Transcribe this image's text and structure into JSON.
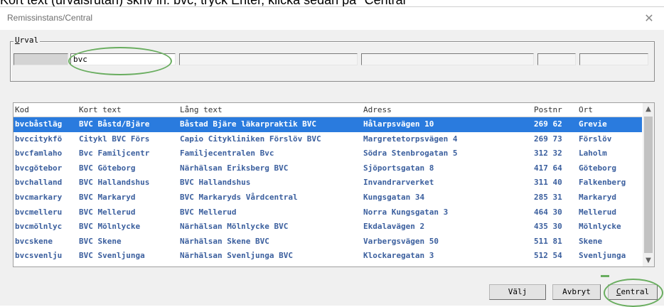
{
  "caption": "Kort text (urvalsrutan) skriv in: bvc, tryck Enter, klicka sedan på \"Central\"",
  "window": {
    "title": "Remissinstans/Central",
    "close_icon": "close-icon"
  },
  "urval": {
    "legend_first": "U",
    "legend_rest": "rval",
    "search_value": "bvc"
  },
  "table": {
    "columns": [
      "Kod",
      "Kort text",
      "Lång text",
      "Adress",
      "Postnr",
      "Ort"
    ],
    "rows": [
      {
        "kod": "bvcbåstläg",
        "kort": "BVC Båstd/Bjäre",
        "lang": "Båstad Bjäre läkarpraktik BVC",
        "adress": "Hålarpsvägen 10",
        "postnr": "269 62",
        "ort": "Grevie"
      },
      {
        "kod": "bvccitykfö",
        "kort": "Citykl BVC Förs",
        "lang": "Capio Citykliniken Förslöv BVC",
        "adress": "Margretetorpsvägen 4",
        "postnr": "269 73",
        "ort": "Förslöv"
      },
      {
        "kod": "bvcfamlaho",
        "kort": "Bvc Familjcentr",
        "lang": "Familjecentralen Bvc",
        "adress": "Södra Stenbrogatan 5",
        "postnr": "312 32",
        "ort": "Laholm"
      },
      {
        "kod": "bvcgötebor",
        "kort": "BVC Göteborg",
        "lang": "Närhälsan Eriksberg BVC",
        "adress": "Sjöportsgatan 8",
        "postnr": "417 64",
        "ort": "Göteborg"
      },
      {
        "kod": "bvchalland",
        "kort": "BVC Hallandshus",
        "lang": "BVC Hallandshus",
        "adress": "Invandrarverket",
        "postnr": "311 40",
        "ort": "Falkenberg"
      },
      {
        "kod": "bvcmarkary",
        "kort": "BVC Markaryd",
        "lang": "BVC Markaryds Vårdcentral",
        "adress": "Kungsgatan 34",
        "postnr": "285 31",
        "ort": "Markaryd"
      },
      {
        "kod": "bvcmelleru",
        "kort": "BVC Mellerud",
        "lang": "BVC Mellerud",
        "adress": "Norra Kungsgatan 3",
        "postnr": "464 30",
        "ort": "Mellerud"
      },
      {
        "kod": "bvcmölnlyc",
        "kort": "BVC Mölnlycke",
        "lang": "Närhälsan Mölnlycke BVC",
        "adress": "Ekdalavägen 2",
        "postnr": "435 30",
        "ort": "Mölnlycke"
      },
      {
        "kod": "bvcskene",
        "kort": "BVC Skene",
        "lang": "Närhälsan Skene BVC",
        "adress": "Varbergsvägen 50",
        "postnr": "511 81",
        "ort": "Skene"
      },
      {
        "kod": "bvcsvenlju",
        "kort": "BVC Svenljunga",
        "lang": "Närhälsan Svenljunga BVC",
        "adress": "Klockaregatan 3",
        "postnr": "512 54",
        "ort": "Svenljunga"
      }
    ],
    "selected_index": 0
  },
  "buttons": {
    "valj": "Välj",
    "avbryt": "Avbryt",
    "central_first": "C",
    "central_rest": "entral"
  },
  "colors": {
    "selection": "#2a7bde",
    "row_text": "#3b5f9e",
    "highlight_ring": "#69ad5f"
  }
}
